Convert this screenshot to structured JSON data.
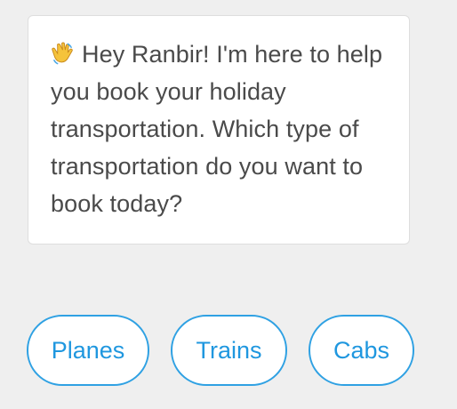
{
  "message": {
    "emoji_icon": "waving-hand-icon",
    "text": "Hey Ranbir! I'm here to help you book your holiday transportation. Which type of transportation do you want to book today?"
  },
  "quick_replies": [
    {
      "label": "Planes"
    },
    {
      "label": "Trains"
    },
    {
      "label": "Cabs"
    }
  ],
  "colors": {
    "background": "#efefef",
    "bubble_background": "#ffffff",
    "text": "#4a4a4a",
    "accent": "#2fa1e3"
  }
}
